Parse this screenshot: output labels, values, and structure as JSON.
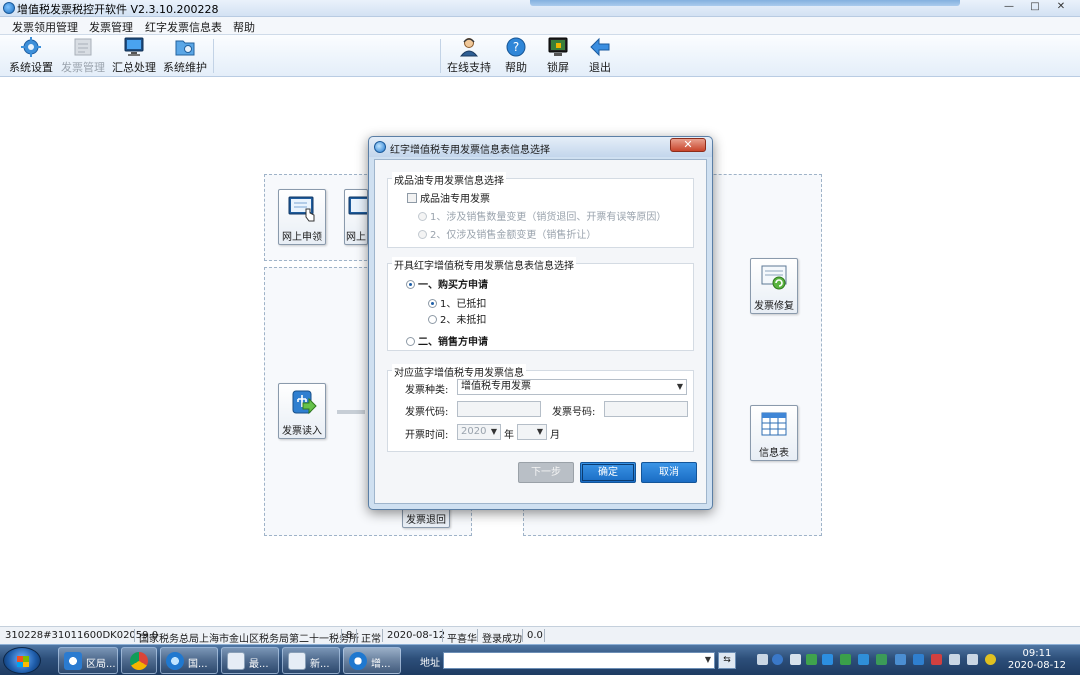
{
  "window": {
    "title": "增值税发票税控开软件 V2.3.10.200228",
    "min_label": "—",
    "max_label": "□",
    "close_label": "✕"
  },
  "menu": [
    "发票领用管理",
    "发票管理",
    "红字发票信息表",
    "帮助"
  ],
  "toolbar": {
    "left": [
      {
        "label": "系统设置",
        "icon": "gear-icon",
        "enabled": true
      },
      {
        "label": "发票管理",
        "icon": "invoice-icon",
        "enabled": false
      },
      {
        "label": "汇总处理",
        "icon": "monitor-icon",
        "enabled": true
      },
      {
        "label": "系统维护",
        "icon": "folder-gear-icon",
        "enabled": true
      }
    ],
    "right": [
      {
        "label": "在线支持",
        "icon": "user-support-icon"
      },
      {
        "label": "帮助",
        "icon": "help-icon"
      },
      {
        "label": "锁屏",
        "icon": "lock-screen-icon"
      },
      {
        "label": "退出",
        "icon": "exit-arrow-icon"
      }
    ]
  },
  "workspace": {
    "buttons": {
      "online_apply": "网上申领",
      "online_partial": "网上",
      "invoice_read": "发票读入",
      "invoice_return": "发票退回",
      "invoice_repair": "发票修复",
      "info_table": "信息表"
    }
  },
  "dialog": {
    "title": "红字增值税专用发票信息表信息选择",
    "close_label": "✕",
    "group1": {
      "title": "成品油专用发票信息选择",
      "checkbox_label": "成品油专用发票",
      "checkbox_checked": false,
      "options": [
        "1、涉及销售数量变更（销货退回、开票有误等原因）",
        "2、仅涉及销售金额变更（销售折让）"
      ]
    },
    "group2": {
      "title": "开具红字增值税专用发票信息表信息选择",
      "buyer_label": "一、购买方申请",
      "buyer_options": [
        "1、已抵扣",
        "2、未抵扣"
      ],
      "seller_label": "二、销售方申请"
    },
    "group3": {
      "title": "对应蓝字增值税专用发票信息",
      "type_label": "发票种类:",
      "type_value": "增值税专用发票",
      "code_label": "发票代码:",
      "code_value": "",
      "number_label": "发票号码:",
      "number_value": "",
      "date_label": "开票时间:",
      "year_value": "2020",
      "year_unit": "年",
      "month_value": "",
      "month_unit": "月"
    },
    "buttons": {
      "next": "下一步",
      "ok": "确定",
      "cancel": "取消"
    }
  },
  "statusbar": [
    "310228#31011600DK02059.0",
    "国家税务总局上海市金山区税务局第二十一税务所",
    "8",
    "正常",
    "2020-08-12",
    "平喜华",
    "登录成功",
    "0.0"
  ],
  "taskbar": {
    "tasks": [
      "区局...",
      "",
      "国...",
      "最...",
      "新...",
      "增..."
    ],
    "address_label": "地址",
    "clock_time": "09:11",
    "clock_date": "2020-08-12"
  }
}
